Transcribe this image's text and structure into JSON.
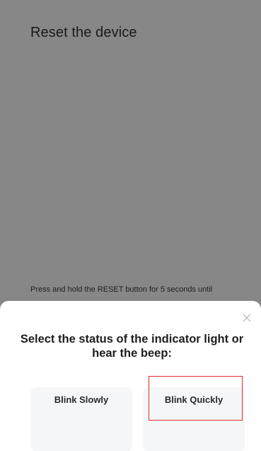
{
  "screen": {
    "title": "Reset the device",
    "instruction": "Press and hold the RESET button for 5 seconds until"
  },
  "sheet": {
    "title": "Select the status of the indicator light or hear the beep:",
    "close_icon": "close-icon",
    "options": [
      {
        "label": "Blink Slowly"
      },
      {
        "label": "Blink Quickly",
        "highlighted": true
      }
    ]
  },
  "colors": {
    "backdrop": "#878787",
    "sheet": "#ffffff",
    "option_card": "#f5f6f8",
    "highlight": "#e12a2a"
  }
}
